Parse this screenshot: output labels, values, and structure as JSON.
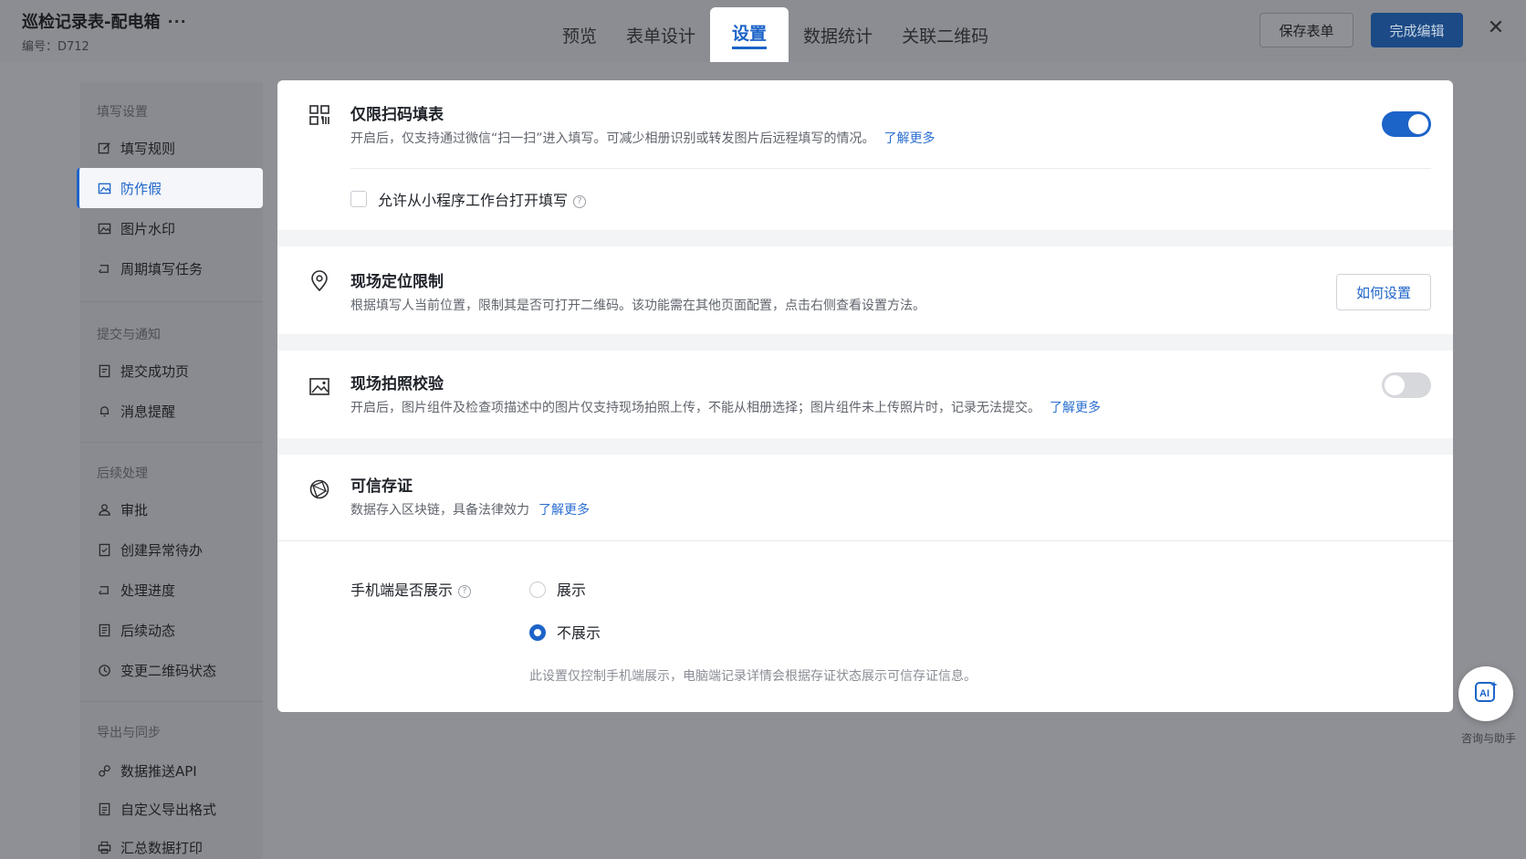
{
  "header": {
    "title": "巡检记录表-配电箱",
    "code": "编号：D712",
    "more": "···",
    "tabs": [
      {
        "label": "预览"
      },
      {
        "label": "表单设计"
      },
      {
        "label": "设置",
        "active": true
      },
      {
        "label": "数据统计"
      },
      {
        "label": "关联二维码"
      }
    ],
    "save_label": "保存表单",
    "done_label": "完成编辑",
    "close": "✕"
  },
  "sidebar": {
    "groups": [
      {
        "title": "填写设置",
        "items": [
          {
            "label": "填写规则",
            "icon": "edit-icon"
          },
          {
            "label": "防作假",
            "icon": "image-shield-icon",
            "active": true
          },
          {
            "label": "图片水印",
            "icon": "image-icon"
          },
          {
            "label": "周期填写任务",
            "icon": "cycle-icon"
          }
        ]
      },
      {
        "title": "提交与通知",
        "items": [
          {
            "label": "提交成功页",
            "icon": "page-icon"
          },
          {
            "label": "消息提醒",
            "icon": "bell-icon"
          }
        ]
      },
      {
        "title": "后续处理",
        "items": [
          {
            "label": "审批",
            "icon": "user-icon"
          },
          {
            "label": "创建异常待办",
            "icon": "todo-icon"
          },
          {
            "label": "处理进度",
            "icon": "progress-icon"
          },
          {
            "label": "后续动态",
            "icon": "doc-icon"
          },
          {
            "label": "变更二维码状态",
            "icon": "status-icon"
          }
        ]
      },
      {
        "title": "导出与同步",
        "items": [
          {
            "label": "数据推送API",
            "icon": "link-icon"
          },
          {
            "label": "自定义导出格式",
            "icon": "export-icon"
          },
          {
            "label": "汇总数据打印",
            "icon": "print-icon"
          }
        ]
      }
    ]
  },
  "settings": {
    "scan_only": {
      "title": "仅限扫码填表",
      "desc": "开启后，仅支持通过微信“扫一扫”进入填写。可减少相册识别或转发图片后远程填写的情况。",
      "link": "了解更多",
      "enabled": true,
      "checkbox_label": "允许从小程序工作台打开填写",
      "checkbox_checked": false
    },
    "location": {
      "title": "现场定位限制",
      "desc": "根据填写人当前位置，限制其是否可打开二维码。该功能需在其他页面配置，点击右侧查看设置方法。",
      "button": "如何设置"
    },
    "photo": {
      "title": "现场拍照校验",
      "desc": "开启后，图片组件及检查项描述中的图片仅支持现场拍照上传，不能从相册选择；图片组件未上传照片时，记录无法提交。",
      "link": "了解更多",
      "enabled": false
    },
    "trusted": {
      "title": "可信存证",
      "desc": "数据存入区块链，具备法律效力",
      "link": "了解更多",
      "mobile_label": "手机端是否展示",
      "options": [
        {
          "label": "展示",
          "checked": false
        },
        {
          "label": "不展示",
          "checked": true
        }
      ],
      "note": "此设置仅控制手机端展示，电脑端记录详情会根据存证状态展示可信存证信息。"
    }
  },
  "assistant": {
    "label": "咨询与助手",
    "icon": "ai-icon"
  },
  "colors": {
    "accent": "#1d64c8",
    "link": "#2b6fd1",
    "overlay": "#8e9095"
  }
}
